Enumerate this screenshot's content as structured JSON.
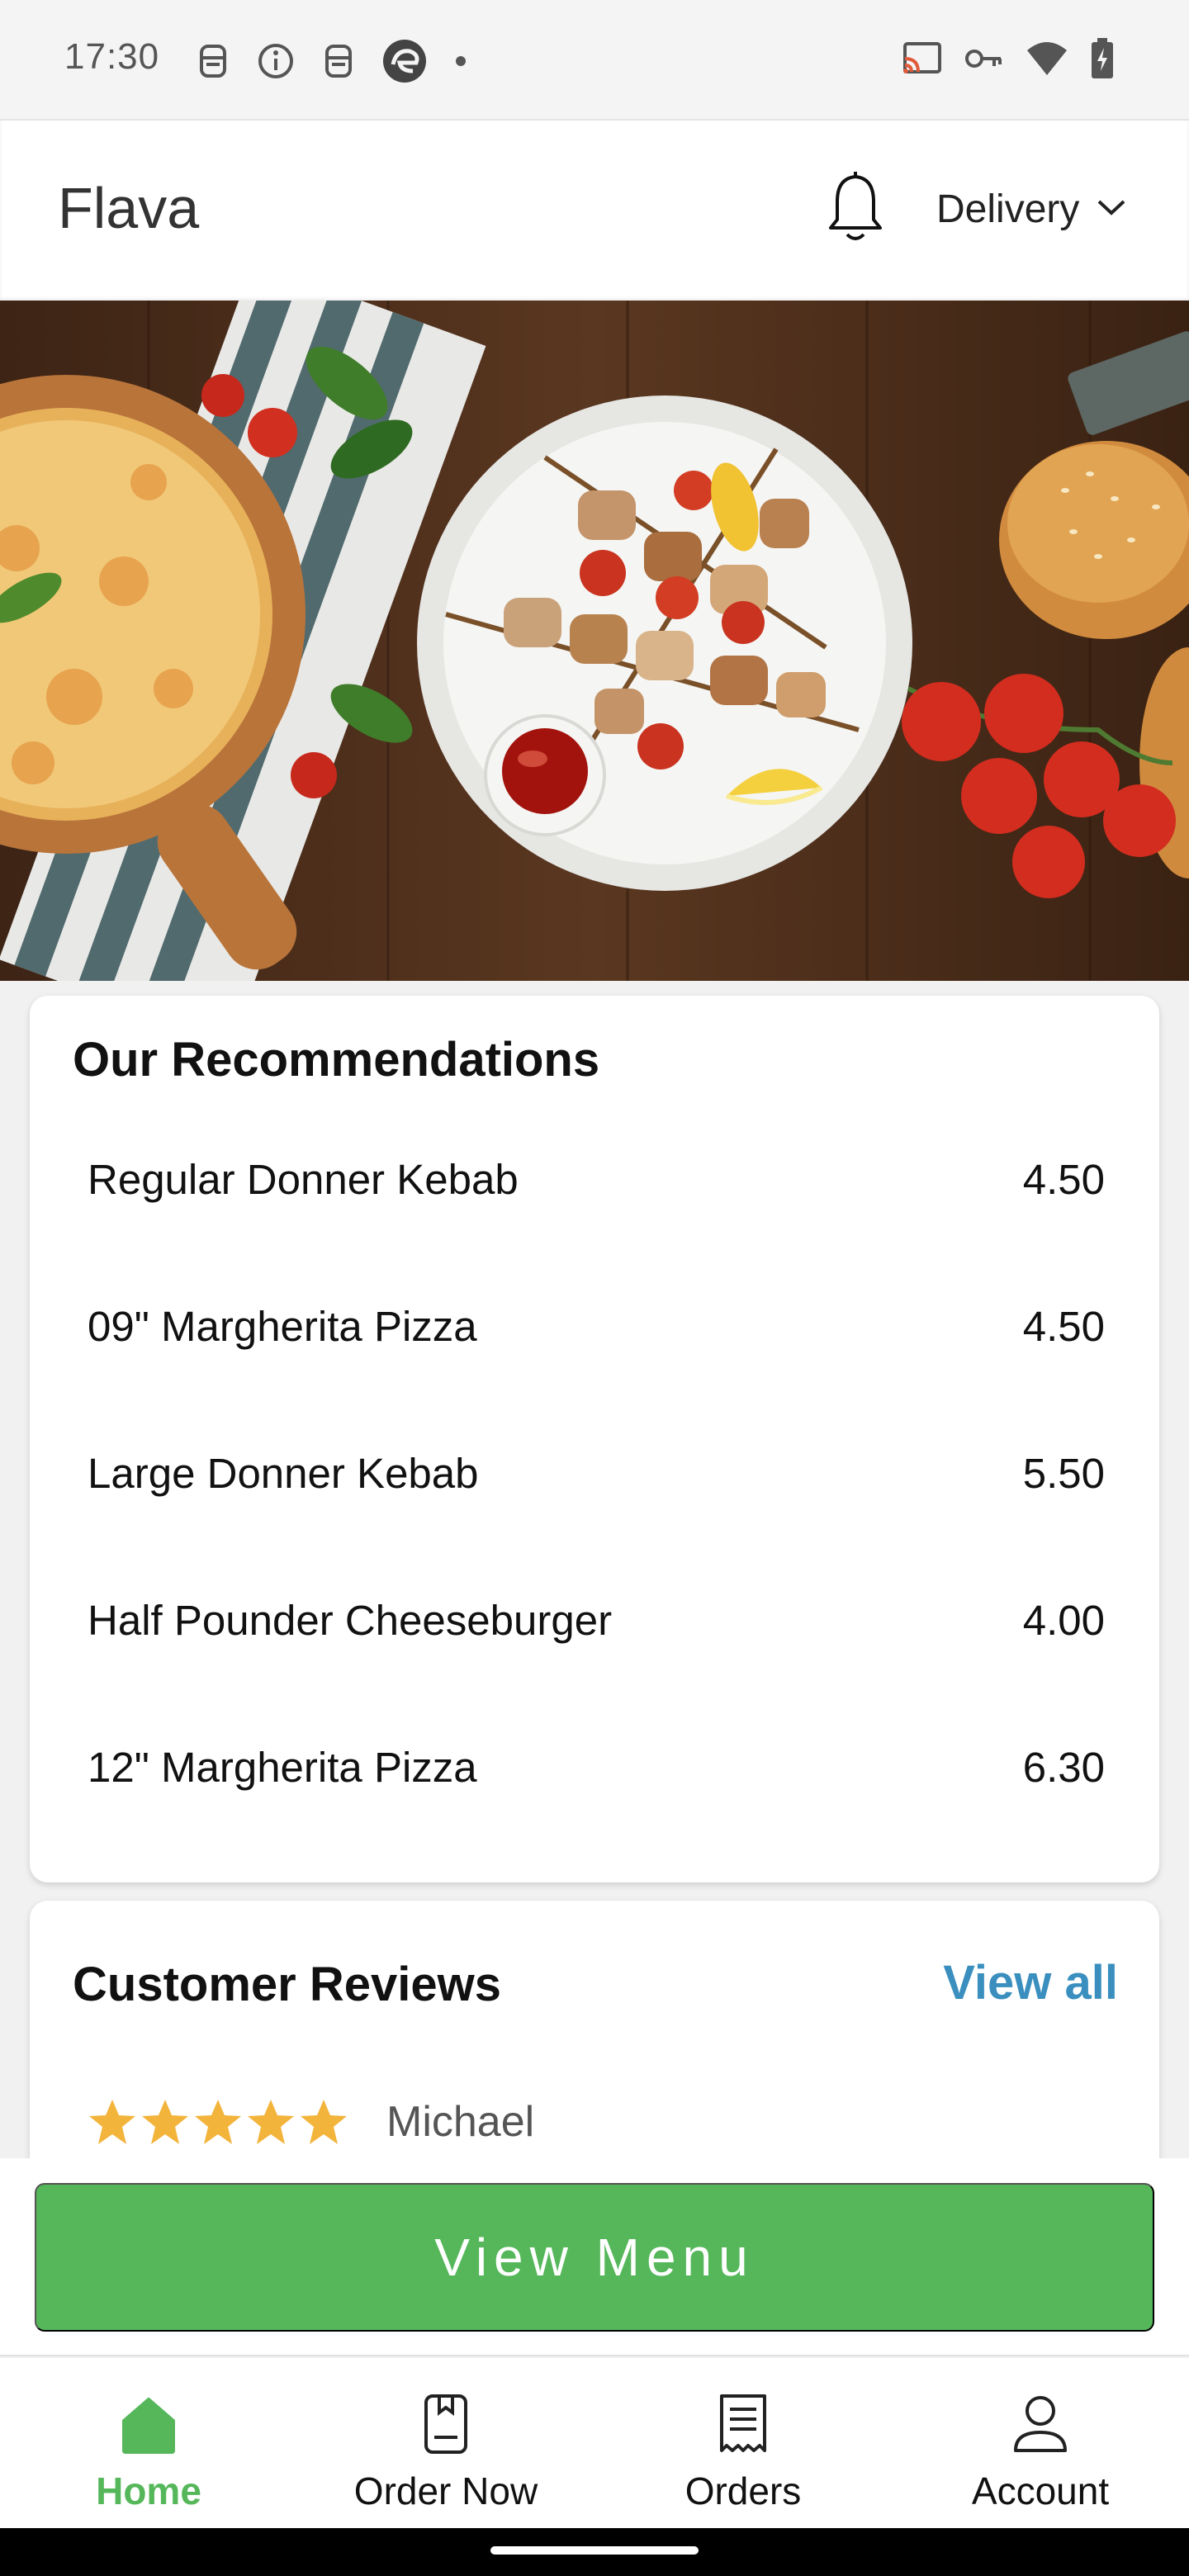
{
  "status_bar": {
    "time": "17:30",
    "left_icons": [
      "robot-icon",
      "info-icon",
      "robot-icon",
      "edge-browser-icon",
      "dot-icon"
    ],
    "right_icons": [
      "cast-icon",
      "vpn-key-icon",
      "wifi-icon",
      "battery-icon"
    ]
  },
  "header": {
    "title": "Flava",
    "notification_icon": "bell-icon",
    "mode_selector": {
      "label": "Delivery",
      "icon": "chevron-down-icon"
    }
  },
  "hero": {
    "description_icon": "food-banner-image"
  },
  "recommendations": {
    "title": "Our Recommendations",
    "items": [
      {
        "name": "Regular Donner Kebab",
        "price": "4.50"
      },
      {
        "name": "09\" Margherita Pizza",
        "price": "4.50"
      },
      {
        "name": "Large Donner Kebab",
        "price": "5.50"
      },
      {
        "name": "Half Pounder Cheeseburger",
        "price": "4.00"
      },
      {
        "name": "12\" Margherita Pizza",
        "price": "6.30"
      }
    ]
  },
  "reviews": {
    "title": "Customer Reviews",
    "view_all_label": "View all",
    "items": [
      {
        "rating": 5,
        "reviewer": "Michael"
      }
    ]
  },
  "cta": {
    "label": "View Menu"
  },
  "bottom_nav": {
    "items": [
      {
        "label": "Home",
        "icon": "home-icon",
        "active": true
      },
      {
        "label": "Order Now",
        "icon": "order-document-icon",
        "active": false
      },
      {
        "label": "Orders",
        "icon": "receipt-icon",
        "active": false
      },
      {
        "label": "Account",
        "icon": "user-icon",
        "active": false
      }
    ]
  },
  "colors": {
    "accent_green": "#55b75a",
    "link_blue": "#3a8fbf",
    "star_gold": "#f3b43c"
  }
}
